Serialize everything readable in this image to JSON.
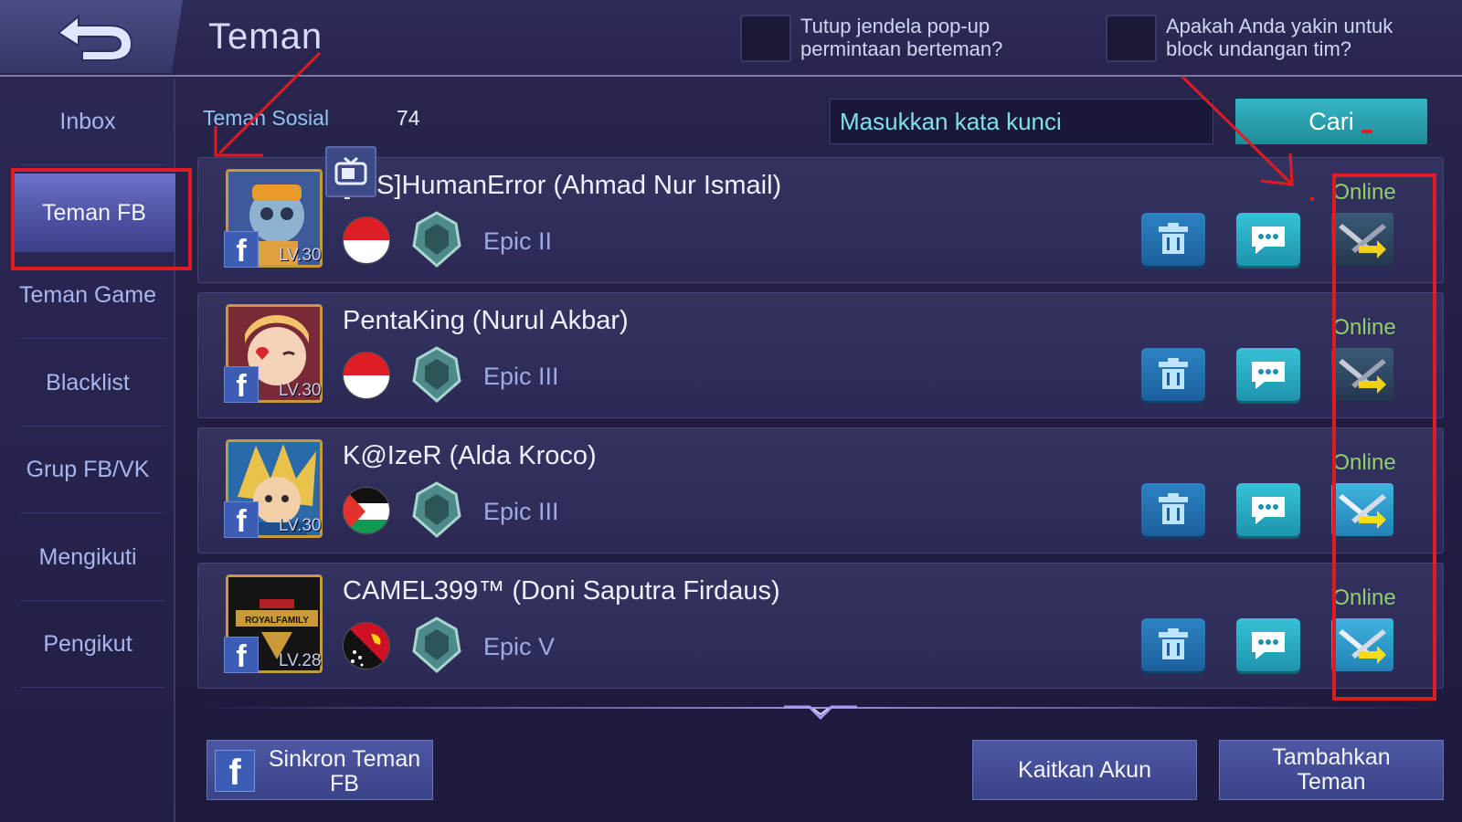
{
  "header": {
    "title": "Teman",
    "checkbox_popup_label": "Tutup jendela pop-up permintaan berteman?",
    "checkbox_block_label": "Apakah Anda yakin untuk block undangan tim?"
  },
  "sidebar": {
    "items": [
      {
        "label": "Inbox"
      },
      {
        "label": "Teman FB"
      },
      {
        "label": "Teman Game"
      },
      {
        "label": "Blacklist"
      },
      {
        "label": "Grup FB/VK"
      },
      {
        "label": "Mengikuti"
      },
      {
        "label": "Pengikut"
      }
    ]
  },
  "social": {
    "label": "Teman Sosial",
    "count": "74"
  },
  "search": {
    "placeholder": "Masukkan kata kunci",
    "button": "Cari"
  },
  "friends": [
    {
      "name": "[-AS]HumanError (Ahmad Nur Ismail)",
      "level": "LV.30",
      "flag": "indonesia",
      "rank": "Epic II",
      "status": "Online",
      "battle_style": "dark"
    },
    {
      "name": "PentaKing (Nurul Akbar)",
      "level": "LV.30",
      "flag": "indonesia",
      "rank": "Epic III",
      "status": "Online",
      "battle_style": "dark"
    },
    {
      "name": "K@IzeR (Alda Kroco)",
      "level": "LV.30",
      "flag": "palestine",
      "rank": "Epic III",
      "status": "Online",
      "battle_style": "light"
    },
    {
      "name": "CAMEL399™ (Doni Saputra Firdaus)",
      "level": "LV.28",
      "flag": "papua-new-guinea",
      "rank": "Epic V",
      "status": "Online",
      "battle_style": "light"
    }
  ],
  "avatar4_text": "ROYALFAMILY",
  "bottom": {
    "sync_label": "Sinkron Teman FB",
    "link_label": "Kaitkan Akun",
    "add_label": "Tambahkan Teman"
  },
  "colors": {
    "online": "#8fd06a",
    "search_button": "#2aa3b2",
    "annotation": "#e11b22"
  }
}
